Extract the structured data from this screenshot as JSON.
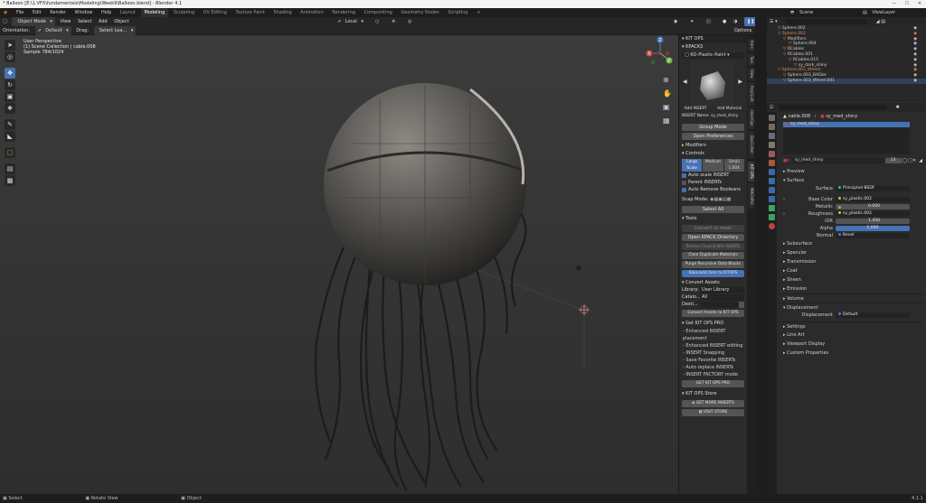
{
  "window": {
    "title": "* Balloon [E:\\1.VFX\\fundamentals\\Modeling\\Week9\\Balloon.blend] - Blender 4.1"
  },
  "menubar": {
    "menus": [
      "File",
      "Edit",
      "Render",
      "Window",
      "Help"
    ],
    "workspaces": [
      "Layout",
      "Modeling",
      "Sculpting",
      "UV Editing",
      "Texture Paint",
      "Shading",
      "Animation",
      "Rendering",
      "Compositing",
      "Geometry Nodes",
      "Scripting"
    ],
    "active_workspace": "Modeling",
    "scene": "Scene",
    "view_layer": "ViewLayer"
  },
  "toolheader": {
    "mode": "Object Mode",
    "menus": [
      "View",
      "Select",
      "Add",
      "Object"
    ],
    "transform_orientation": "Local"
  },
  "tooloptions": {
    "orientation_label": "Orientation:",
    "orientation_value": "Default",
    "drag_label": "Drag:",
    "drag_value": "Select Lea...",
    "options": "Options"
  },
  "viewport": {
    "info_line1": "User Perspective",
    "info_line2": "(1) Scene Collection | cable.008",
    "info_line3": "Sample 784/1024",
    "gizmo_axes": [
      "X",
      "Y",
      "Z"
    ]
  },
  "npanel": {
    "header": "KIT OPS",
    "kpacks_label": "KPACKS",
    "kpack_value": "KO-Plastic-Paint",
    "add_insert": "Add INSERT",
    "add_material": "Add Material",
    "insert_name": "INSERT Name: sy_med_shiny",
    "group_mode": "Group Mode",
    "open_preferences": "Open Preferences",
    "modifiers": "Modifiers",
    "controls": "Controls",
    "scale_large": "Large",
    "scale_medium": "Medium",
    "scale_small": "Small",
    "scale_label": "Scale",
    "scale_value": "1.00X",
    "auto_scale": "Auto scale INSERT",
    "parent_inserts": "Parent INSERTs",
    "auto_remove": "Auto Remove Booleans",
    "snap_mode": "Snap Mode:",
    "select_all": "Select All",
    "tools": "Tools",
    "convert_to_mesh": "Convert to mesh",
    "open_kpack_dir": "Open KPACK Directory",
    "remove_unused": "Remove Unused Wire INSERTs",
    "clear_duplicate": "Clear Duplicate Materials",
    "purge_data": "Purge Recursive Data Blocks",
    "bake_kitops": "Bake/add item to KITOPS",
    "convert_assets": "Convert Assets",
    "library_label": "Library:",
    "library_value": "User Library",
    "catalog_label": "Catalo...",
    "catalog_value": "All",
    "dest_label": "Desti...",
    "convert_btn": "Convert Assets to KIT OPS",
    "get_pro": "Get KIT OPS PRO",
    "pro_features": [
      "- Enhanced INSERT placement",
      "- Enhanced INSERT editing",
      "- INSERT Snapping",
      "- Save Favorite INSERTs",
      "- Auto replace INSERTs",
      "- INSERT FACTORY mode"
    ],
    "get_pro_btn": "GET KIT OPS PRO",
    "store": "KIT OPS Store",
    "get_more": "GET MORE INSERTS",
    "visit_store": "VISIT STORE"
  },
  "vtabs": [
    "Item",
    "Tool",
    "View",
    "PolyQuilt",
    "HardOps",
    "BoxCutter",
    "KIT OPS",
    "MACHIN3"
  ],
  "outliner": {
    "search_placeholder": "",
    "rows": [
      {
        "indent": 2,
        "label": "Sphere.002",
        "hl": false,
        "sel": false
      },
      {
        "indent": 2,
        "label": "Sphere.003",
        "hl": true,
        "sel": false
      },
      {
        "indent": 3,
        "label": "Modifiers",
        "hl": false,
        "sel": false
      },
      {
        "indent": 4,
        "label": "Sphere.004",
        "hl": false,
        "sel": false
      },
      {
        "indent": 3,
        "label": "RCables",
        "hl": false,
        "sel": false
      },
      {
        "indent": 3,
        "label": "RCables.001",
        "hl": false,
        "sel": false
      },
      {
        "indent": 4,
        "label": "RCables.015",
        "hl": false,
        "sel": false
      },
      {
        "indent": 5,
        "label": "sy_dark_shiny",
        "hl": false,
        "sel": false
      },
      {
        "indent": 2,
        "label": "Sphere.003_Wheel",
        "hl": true,
        "sel": false
      },
      {
        "indent": 3,
        "label": "Sphere.003_BADze",
        "hl": false,
        "sel": false
      },
      {
        "indent": 3,
        "label": "Sphere.003_Wheel.001",
        "hl": false,
        "sel": true
      }
    ]
  },
  "properties": {
    "breadcrumb_obj": "cable.008",
    "breadcrumb_mat": "sy_med_shiny",
    "slot": "sy_med_shiny",
    "material_name": "sy_med_shiny",
    "users": "13",
    "sections": {
      "preview": "Preview",
      "surface": "Surface",
      "subsurface": "Subsurface",
      "specular": "Specular",
      "transmission": "Transmission",
      "coat": "Coat",
      "sheen": "Sheen",
      "emission": "Emission",
      "volume": "Volume",
      "displacement": "Displacement",
      "settings": "Settings",
      "line_art": "Line Art",
      "viewport_display": "Viewport Display",
      "custom_properties": "Custom Properties"
    },
    "surface_label": "Surface",
    "surface_value": "Principled BSDF",
    "base_color_label": "Base Color",
    "base_color_value": "sy_plastic.002",
    "metallic_label": "Metallic",
    "metallic_value": "0.000",
    "roughness_label": "Roughness",
    "roughness_value": "sy_plastic.002",
    "ior_label": "IOR",
    "ior_value": "1.450",
    "alpha_label": "Alpha",
    "alpha_value": "1.000",
    "normal_label": "Normal",
    "normal_value": "Bevel",
    "displacement_label": "Displacement",
    "displacement_value": "Default"
  },
  "statusbar": {
    "select": "Select",
    "rotate": "Rotate View",
    "object": "Object",
    "version": "4.1.1"
  }
}
